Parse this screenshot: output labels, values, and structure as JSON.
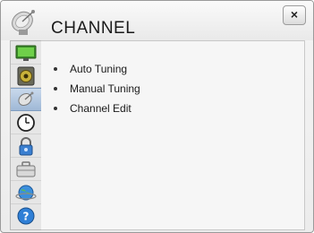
{
  "header": {
    "title": "CHANNEL",
    "icon": "satellite-dish-icon",
    "close_label": "×"
  },
  "sidebar": {
    "items": [
      {
        "icon": "picture-icon",
        "name": "Picture"
      },
      {
        "icon": "audio-icon",
        "name": "Audio"
      },
      {
        "icon": "channel-icon",
        "name": "Channel",
        "selected": true
      },
      {
        "icon": "time-icon",
        "name": "Time"
      },
      {
        "icon": "lock-icon",
        "name": "Lock"
      },
      {
        "icon": "option-icon",
        "name": "Option"
      },
      {
        "icon": "network-icon",
        "name": "Network"
      },
      {
        "icon": "support-icon",
        "name": "Support"
      }
    ]
  },
  "menu": {
    "items": [
      {
        "label": "Auto Tuning"
      },
      {
        "label": "Manual Tuning"
      },
      {
        "label": "Channel Edit"
      }
    ]
  },
  "colors": {
    "selected_bg": "#a9c0dc",
    "panel_bg": "#ececec"
  }
}
